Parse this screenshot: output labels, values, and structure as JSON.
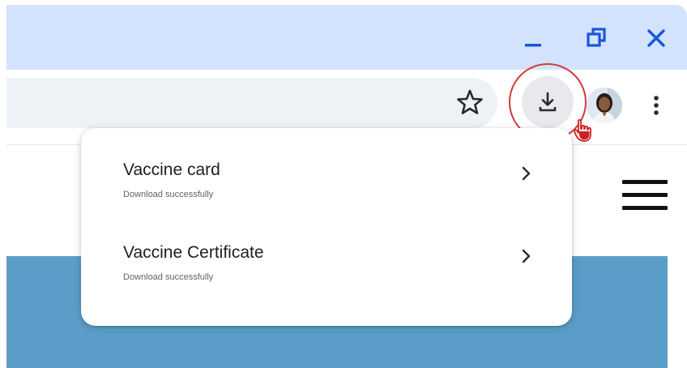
{
  "window_controls": {
    "minimize_icon": "minimize-icon",
    "restore_icon": "restore-icon",
    "close_icon": "close-icon"
  },
  "toolbar": {
    "bookmark_icon": "star-icon",
    "downloads_icon": "download-icon",
    "menu_icon": "three-dots-vertical-icon",
    "accent_color": "#1a56d9",
    "highlight_color": "#d33a3a"
  },
  "downloads": {
    "items": [
      {
        "name": "Vaccine card",
        "status": "Download successfully"
      },
      {
        "name": "Vaccine Certificate",
        "status": "Download successfully"
      }
    ]
  },
  "page": {
    "banner_color": "#5b9dc9"
  }
}
